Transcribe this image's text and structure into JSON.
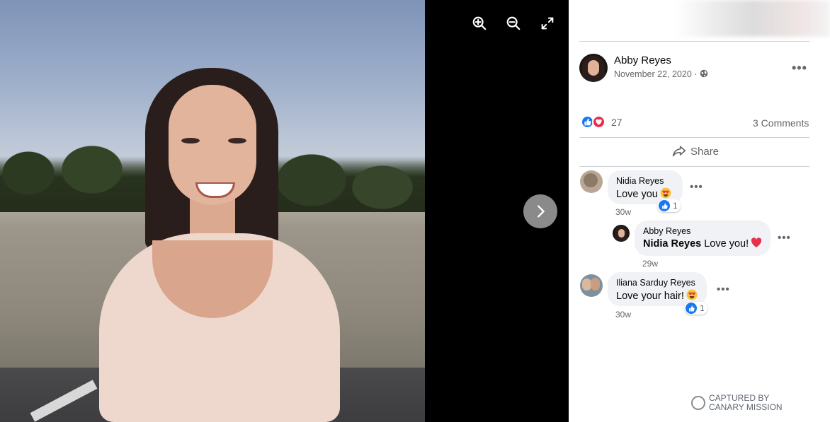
{
  "viewer": {
    "tools": [
      {
        "name": "zoom-in-icon"
      },
      {
        "name": "zoom-out-icon"
      },
      {
        "name": "fullscreen-icon"
      }
    ],
    "next": {
      "icon": "chevron-right-icon"
    }
  },
  "post": {
    "author": "Abby Reyes",
    "date": "November 22, 2020 · ",
    "privacy_icon": "globe-icon",
    "more": "•••",
    "reaction_count": "27",
    "comments_label": "3 Comments",
    "share_label": "Share"
  },
  "comments": [
    {
      "name": "Nidia Reyes",
      "text": "Love you",
      "emoji": "heart-eyes-emoji",
      "time": "30w",
      "likes": "1",
      "more": "•••"
    },
    {
      "name": "Abby Reyes",
      "mention": "Nidia Reyes",
      "text": " Love you!",
      "emoji": "heart-emoji",
      "time": "29w",
      "more": "•••"
    },
    {
      "name": "Iliana Sarduy Reyes",
      "text": "Love your hair!",
      "emoji": "heart-eyes-emoji",
      "time": "30w",
      "likes": "1",
      "more": "•••"
    }
  ],
  "watermark": {
    "line1": "CAPTURED BY",
    "line2": "CANARY MISSION"
  },
  "colors": {
    "like_blue": "#1877f2",
    "love_red": "#f0284a",
    "bubble_gray": "#f0f2f5",
    "meta_gray": "#65676b"
  }
}
